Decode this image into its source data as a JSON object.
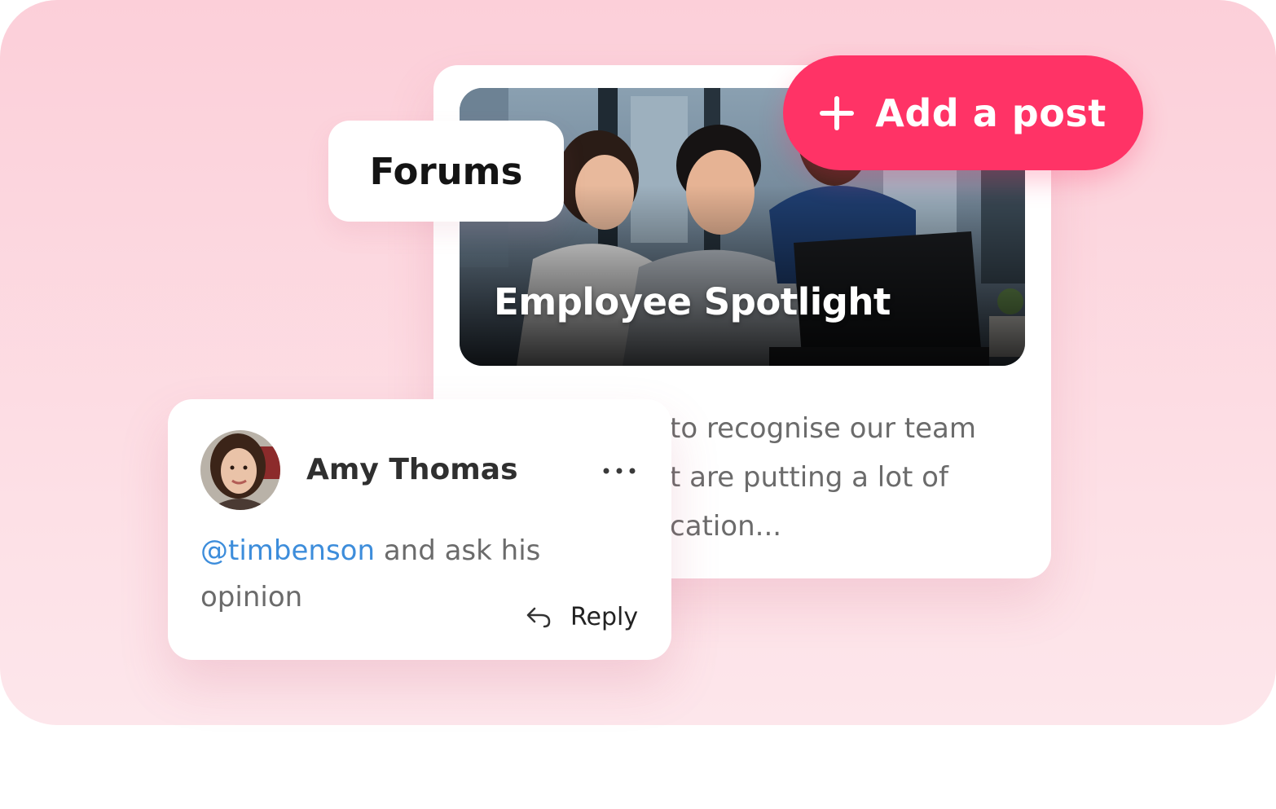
{
  "forums_tab": {
    "label": "Forums"
  },
  "add_post_button": {
    "label": "Add a post",
    "icon": "plus-icon",
    "color": "#ff3366"
  },
  "post_card": {
    "title": "Employee Spotlight",
    "excerpt_lines": [
      "to recognise our team",
      "t are putting a lot of",
      "cation..."
    ]
  },
  "comment": {
    "author": "Amy Thomas",
    "avatar": "avatar-photo",
    "menu_icon": "more-dots-icon",
    "mention": "@timbenson",
    "text": " and ask his opinion",
    "reply_label": "Reply",
    "reply_icon": "reply-arrow-icon",
    "mention_color": "#3d8ddb"
  },
  "colors": {
    "background": "#fccfd9",
    "accent": "#ff3366"
  }
}
